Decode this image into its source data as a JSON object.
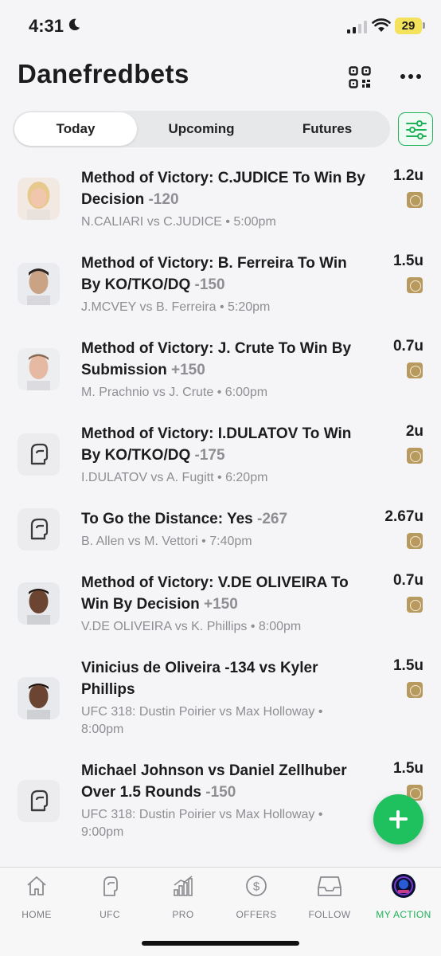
{
  "status_bar": {
    "time": "4:31",
    "battery": "29"
  },
  "app": {
    "title": "Danefredbets"
  },
  "tabs": [
    {
      "label": "Today",
      "active": true
    },
    {
      "label": "Upcoming",
      "active": false
    },
    {
      "label": "Futures",
      "active": false
    }
  ],
  "bets": [
    {
      "title": "Method of Victory: C.JUDICE To Win By Decision ",
      "odds": "-120",
      "subtitle": "N.CALIARI vs C.JUDICE • 5:00pm",
      "units": "1.2u",
      "avatar": "fighter-photo"
    },
    {
      "title": "Method of Victory: B. Ferreira To Win By KO/TKO/DQ ",
      "odds": "-150",
      "subtitle": "J.MCVEY vs B. Ferreira • 5:20pm",
      "units": "1.5u",
      "avatar": "fighter-photo"
    },
    {
      "title": "Method of Victory: J. Crute To Win By Submission ",
      "odds": "+150",
      "subtitle": "M. Prachnio vs J. Crute • 6:00pm",
      "units": "0.7u",
      "avatar": "fighter-photo"
    },
    {
      "title": "Method of Victory: I.DULATOV To Win By KO/TKO/DQ ",
      "odds": "-175",
      "subtitle": "I.DULATOV vs A. Fugitt • 6:20pm",
      "units": "2u",
      "avatar": "boxing-glove-icon"
    },
    {
      "title": "To Go the Distance: Yes ",
      "odds": "-267",
      "subtitle": "B. Allen vs M. Vettori • 7:40pm",
      "units": "2.67u",
      "avatar": "boxing-glove-icon"
    },
    {
      "title": "Method of Victory: V.DE OLIVEIRA To Win By Decision ",
      "odds": "+150",
      "subtitle": "V.DE OLIVEIRA vs K. Phillips • 8:00pm",
      "units": "0.7u",
      "avatar": "fighter-photo"
    },
    {
      "title": "Vinicius de Oliveira -134 vs Kyler Phillips",
      "odds": "",
      "subtitle": "UFC 318: Dustin Poirier vs Max Holloway • 8:00pm",
      "units": "1.5u",
      "avatar": "fighter-photo"
    },
    {
      "title": "Michael Johnson vs Daniel Zellhuber Over 1.5 Rounds ",
      "odds": "-150",
      "subtitle": "UFC 318: Dustin Poirier vs Max Holloway • 9:00pm",
      "units": "1.5u",
      "avatar": "boxing-glove-icon"
    }
  ],
  "bottom_nav": [
    {
      "label": "HOME",
      "icon": "home-icon"
    },
    {
      "label": "UFC",
      "icon": "boxing-glove-icon"
    },
    {
      "label": "PRO",
      "icon": "bar-chart-icon"
    },
    {
      "label": "OFFERS",
      "icon": "dollar-icon"
    },
    {
      "label": "FOLLOW",
      "icon": "inbox-icon"
    },
    {
      "label": "MY ACTION",
      "icon": "profile-avatar-icon",
      "active": true
    }
  ],
  "colors": {
    "accent": "#21b35a",
    "odds_gray": "#8e8e93",
    "sportsbook_gold": "#b89a5e"
  }
}
